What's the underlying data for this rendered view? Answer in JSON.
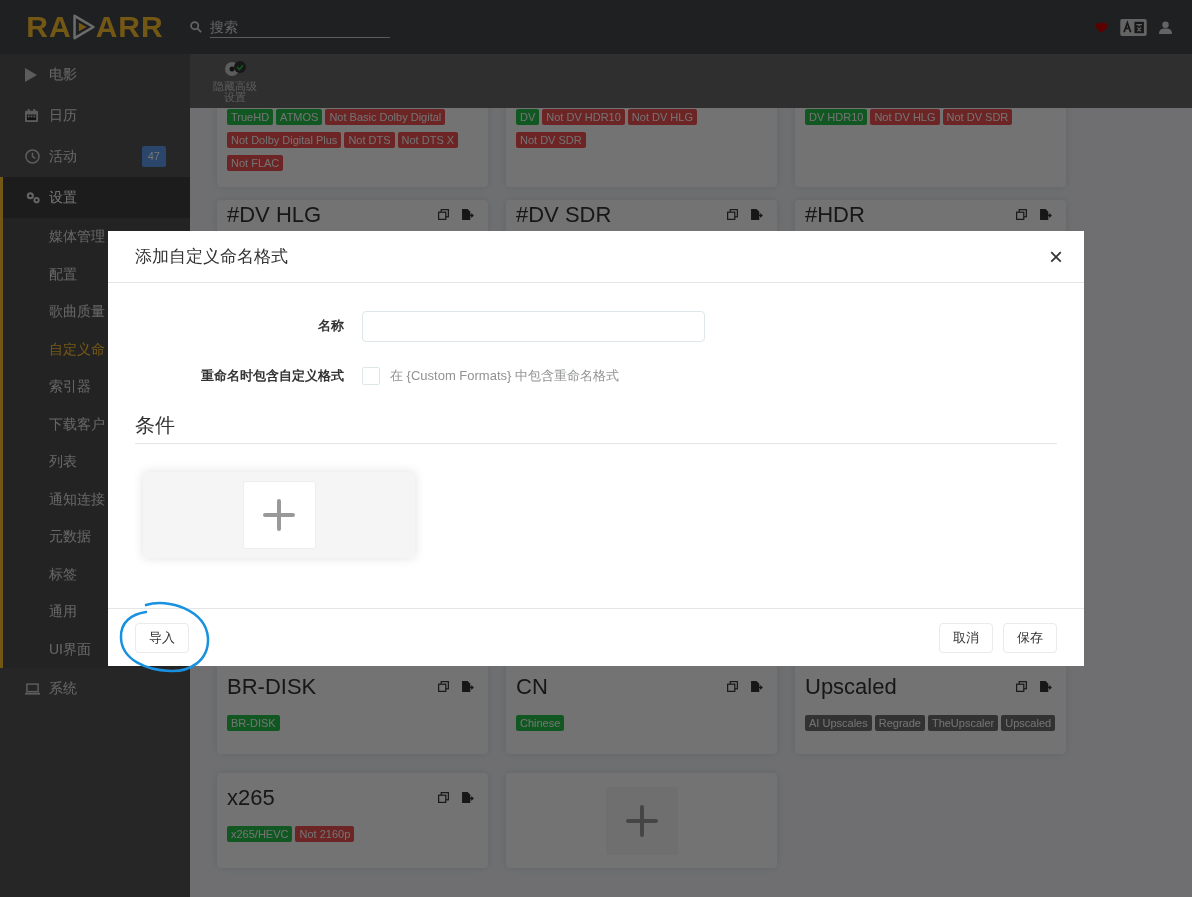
{
  "header": {
    "logo_left": "RA",
    "logo_right": "ARR",
    "search": {
      "placeholder": "搜索"
    }
  },
  "sidebar": {
    "items": [
      {
        "label": "电影",
        "selected": false
      },
      {
        "label": "日历",
        "selected": false
      },
      {
        "label": "活动",
        "selected": false,
        "badge": "47"
      },
      {
        "label": "设置",
        "selected": true,
        "children": [
          {
            "label": "媒体管理",
            "selected": false
          },
          {
            "label": "配置",
            "selected": false
          },
          {
            "label": "歌曲质量",
            "selected": false
          },
          {
            "label": "自定义命",
            "selected": true
          },
          {
            "label": "索引器",
            "selected": false
          },
          {
            "label": "下载客户",
            "selected": false
          },
          {
            "label": "列表",
            "selected": false
          },
          {
            "label": "通知连接",
            "selected": false
          },
          {
            "label": "元数据",
            "selected": false
          },
          {
            "label": "标签",
            "selected": false
          },
          {
            "label": "通用",
            "selected": false
          },
          {
            "label": "UI界面",
            "selected": false
          }
        ]
      },
      {
        "label": "系统",
        "selected": false
      }
    ]
  },
  "toolbar": {
    "button_label": "隐藏高级设置"
  },
  "cards": [
    {
      "tags": [
        {
          "label": "TrueHD",
          "kind": "positive"
        },
        {
          "label": "ATMOS",
          "kind": "positive"
        },
        {
          "label": "Not Basic Dolby Digital",
          "kind": "negative"
        },
        {
          "label": "Not Dolby Digital Plus",
          "kind": "negative"
        },
        {
          "label": "Not DTS",
          "kind": "negative"
        },
        {
          "label": "Not DTS X",
          "kind": "negative"
        },
        {
          "label": "Not FLAC",
          "kind": "negative"
        }
      ]
    },
    {
      "tags": [
        {
          "label": "DV",
          "kind": "positive"
        },
        {
          "label": "Not DV HDR10",
          "kind": "negative"
        },
        {
          "label": "Not DV HLG",
          "kind": "negative"
        },
        {
          "label": "Not DV SDR",
          "kind": "negative"
        }
      ]
    },
    {
      "tags": [
        {
          "label": "DV HDR10",
          "kind": "positive"
        },
        {
          "label": "Not DV HLG",
          "kind": "negative"
        },
        {
          "label": "Not DV SDR",
          "kind": "negative"
        }
      ]
    },
    {
      "title": "#DV HLG"
    },
    {
      "title": "#DV SDR"
    },
    {
      "title": "#HDR"
    },
    {
      "title": "BR-DISK",
      "tags": [
        {
          "label": "BR-DISK",
          "kind": "positive"
        }
      ]
    },
    {
      "title": "CN",
      "tags": [
        {
          "label": "Chinese",
          "kind": "positive"
        }
      ]
    },
    {
      "title": "Upscaled",
      "tags": [
        {
          "label": "AI Upscales",
          "kind": "default"
        },
        {
          "label": "Regrade",
          "kind": "default"
        },
        {
          "label": "TheUpscaler",
          "kind": "default"
        },
        {
          "label": "Upscaled",
          "kind": "default"
        }
      ]
    },
    {
      "title": "x265",
      "tags": [
        {
          "label": "x265/HEVC",
          "kind": "positive"
        },
        {
          "label": "Not 2160p",
          "kind": "negative"
        }
      ]
    }
  ],
  "modal": {
    "title": "添加自定义命名格式",
    "close": "×",
    "name_field": {
      "label": "名称"
    },
    "include_rename": {
      "label": "重命名时包含自定义格式",
      "checkbox_label": "在 {Custom Formats} 中包含重命名格式",
      "checked": false
    },
    "conditions_heading": "条件",
    "buttons": {
      "import": "导入",
      "cancel": "取消",
      "save": "保存"
    }
  }
}
